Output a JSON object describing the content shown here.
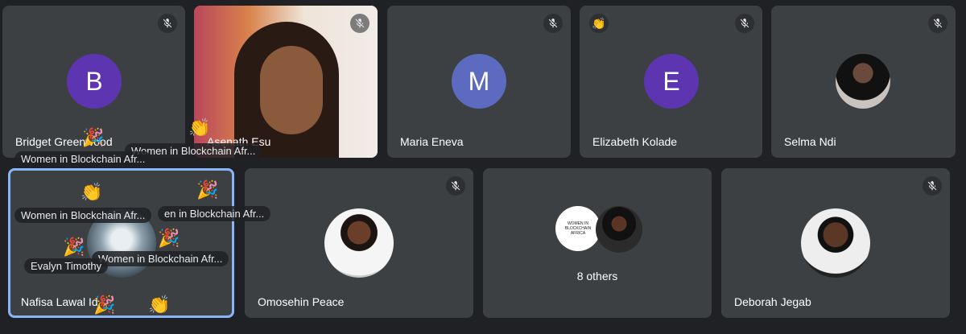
{
  "tiles": [
    {
      "name": "Bridget Greenwood",
      "initial": "B",
      "color": "#5e35b1"
    },
    {
      "name": "Asenath Esu"
    },
    {
      "name": "Maria Eneva",
      "initial": "M",
      "color": "#5c6bc0"
    },
    {
      "name": "Elizabeth Kolade",
      "initial": "E",
      "color": "#5e35b1"
    },
    {
      "name": "Selma Ndi"
    },
    {
      "name": "Nafisa Lawal Id"
    },
    {
      "name": "Omosehin Peace"
    },
    {
      "name": "8 others"
    },
    {
      "name": "Deborah Jegab"
    }
  ],
  "reactions": {
    "women_full": "Women in Blockchain Afr...",
    "women_cut1": "Women in Blockchain Afr...",
    "women_cut2": "en in Blockchain Afr...",
    "evalyn": "Evalyn Timothy"
  },
  "logo_text": "WOMEN IN BLOCKCHAIN AFRICA",
  "emojis": {
    "clap": "👏",
    "party": "🎉",
    "wave": "👋"
  },
  "colors": {
    "accent": "#8ab4f8",
    "tile_bg": "#3c4043",
    "page_bg": "#202124"
  }
}
